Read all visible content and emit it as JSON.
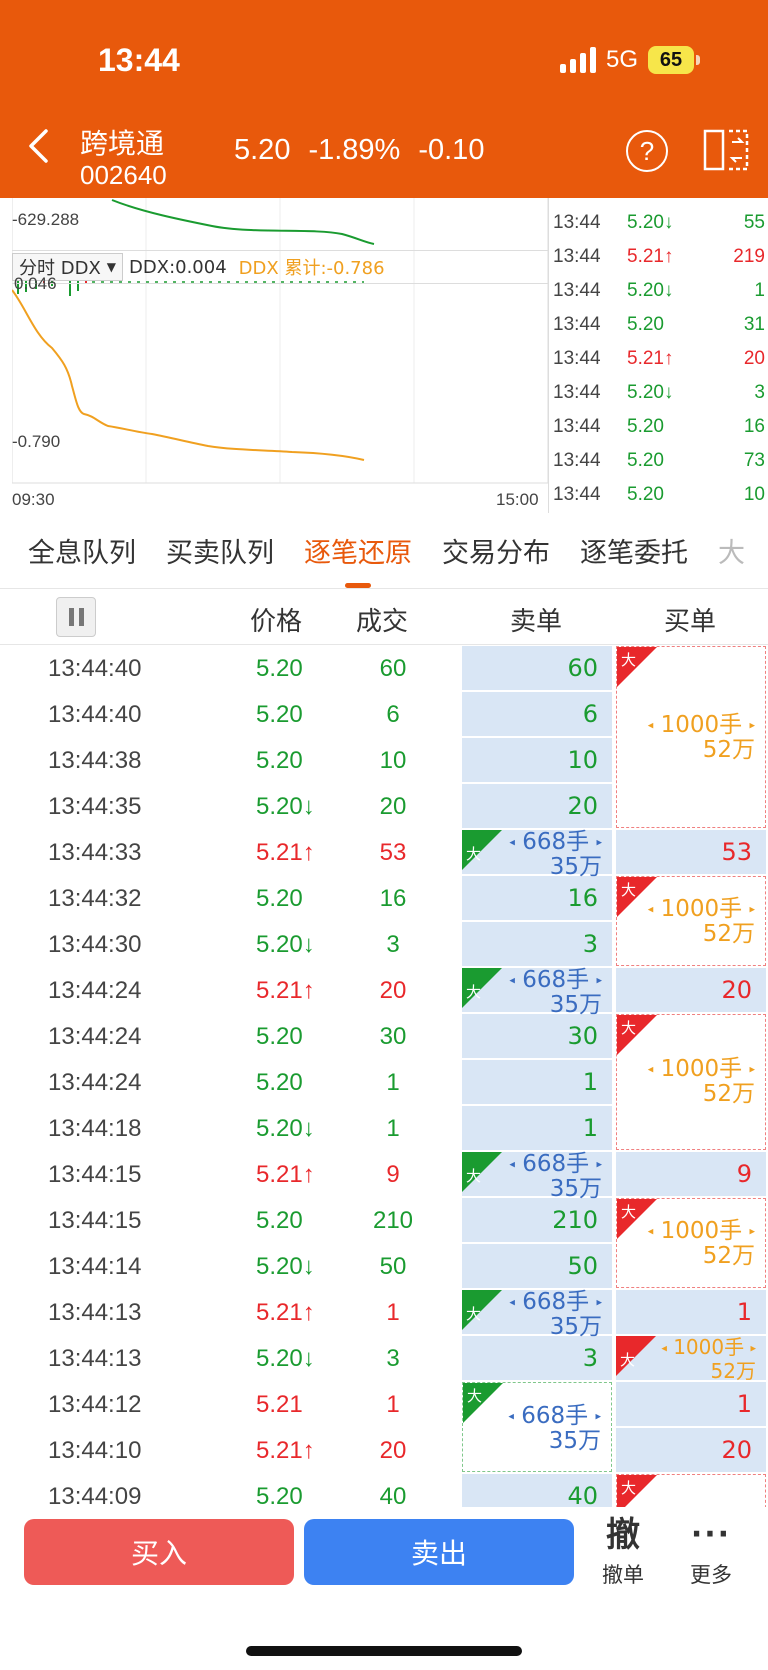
{
  "status": {
    "time": "13:44",
    "network": "5G",
    "battery": "65"
  },
  "stock": {
    "name": "跨境通",
    "code": "002640",
    "price": "5.20",
    "change_pct": "-1.89%",
    "change": "-0.10"
  },
  "header": {
    "help_label": "?"
  },
  "chart": {
    "top_value_label": "-629.288",
    "ddx_select": "分时 DDX",
    "ddx_value": "DDX:0.004",
    "ddx_sum": "DDX 累计:-0.786",
    "ddx_top_label": "0.046",
    "ddx_bottom_label": "-0.790",
    "time_start": "09:30",
    "time_end": "15:00"
  },
  "ticks": [
    {
      "time": "13:44",
      "price": "5.20↓",
      "vol": "55",
      "dir": "down"
    },
    {
      "time": "13:44",
      "price": "5.21↑",
      "vol": "219",
      "dir": "up"
    },
    {
      "time": "13:44",
      "price": "5.20↓",
      "vol": "1",
      "dir": "down"
    },
    {
      "time": "13:44",
      "price": "5.20",
      "vol": "31",
      "dir": "flat"
    },
    {
      "time": "13:44",
      "price": "5.21↑",
      "vol": "20",
      "dir": "up"
    },
    {
      "time": "13:44",
      "price": "5.20↓",
      "vol": "3",
      "dir": "down"
    },
    {
      "time": "13:44",
      "price": "5.20",
      "vol": "16",
      "dir": "flat"
    },
    {
      "time": "13:44",
      "price": "5.20",
      "vol": "73",
      "dir": "flat"
    },
    {
      "time": "13:44",
      "price": "5.20",
      "vol": "10",
      "dir": "flat"
    }
  ],
  "tabs": [
    "全息队列",
    "买卖队列",
    "逐笔还原",
    "交易分布",
    "逐笔委托",
    "大"
  ],
  "active_tab": 2,
  "table_headers": {
    "price": "价格",
    "volume": "成交",
    "sell": "卖单",
    "buy": "买单"
  },
  "big_order": {
    "tag": "大",
    "buy_qty": "1000手",
    "buy_amt": "52万",
    "sell_qty": "668手",
    "sell_amt": "35万"
  },
  "trades": [
    {
      "time": "13:44:40",
      "price": "5.20",
      "vol": "60",
      "side": "sell"
    },
    {
      "time": "13:44:40",
      "price": "5.20",
      "vol": "6",
      "side": "sell"
    },
    {
      "time": "13:44:38",
      "price": "5.20",
      "vol": "10",
      "side": "sell"
    },
    {
      "time": "13:44:35",
      "price": "5.20↓",
      "vol": "20",
      "side": "sell"
    },
    {
      "time": "13:44:33",
      "price": "5.21↑",
      "vol": "53",
      "side": "buy"
    },
    {
      "time": "13:44:32",
      "price": "5.20",
      "vol": "16",
      "side": "sell"
    },
    {
      "time": "13:44:30",
      "price": "5.20↓",
      "vol": "3",
      "side": "sell"
    },
    {
      "time": "13:44:24",
      "price": "5.21↑",
      "vol": "20",
      "side": "buy"
    },
    {
      "time": "13:44:24",
      "price": "5.20",
      "vol": "30",
      "side": "sell"
    },
    {
      "time": "13:44:24",
      "price": "5.20",
      "vol": "1",
      "side": "sell"
    },
    {
      "time": "13:44:18",
      "price": "5.20↓",
      "vol": "1",
      "side": "sell"
    },
    {
      "time": "13:44:15",
      "price": "5.21↑",
      "vol": "9",
      "side": "buy"
    },
    {
      "time": "13:44:15",
      "price": "5.20",
      "vol": "210",
      "side": "sell"
    },
    {
      "time": "13:44:14",
      "price": "5.20↓",
      "vol": "50",
      "side": "sell"
    },
    {
      "time": "13:44:13",
      "price": "5.21↑",
      "vol": "1",
      "side": "buy"
    },
    {
      "time": "13:44:13",
      "price": "5.20↓",
      "vol": "3",
      "side": "sell"
    },
    {
      "time": "13:44:12",
      "price": "5.21",
      "vol": "1",
      "side": "buy"
    },
    {
      "time": "13:44:10",
      "price": "5.21↑",
      "vol": "20",
      "side": "buy"
    },
    {
      "time": "13:44:09",
      "price": "5.20",
      "vol": "40",
      "side": "sell"
    }
  ],
  "bottom": {
    "buy": "买入",
    "sell": "卖出",
    "cancel_glyph": "撤",
    "cancel": "撤单",
    "more_glyph": "···",
    "more": "更多"
  },
  "colors": {
    "header": "#e8590c",
    "up": "#e8282b",
    "down": "#1a9b30",
    "accent": "#f0a020",
    "sell_bg": "#d9e6f5"
  }
}
